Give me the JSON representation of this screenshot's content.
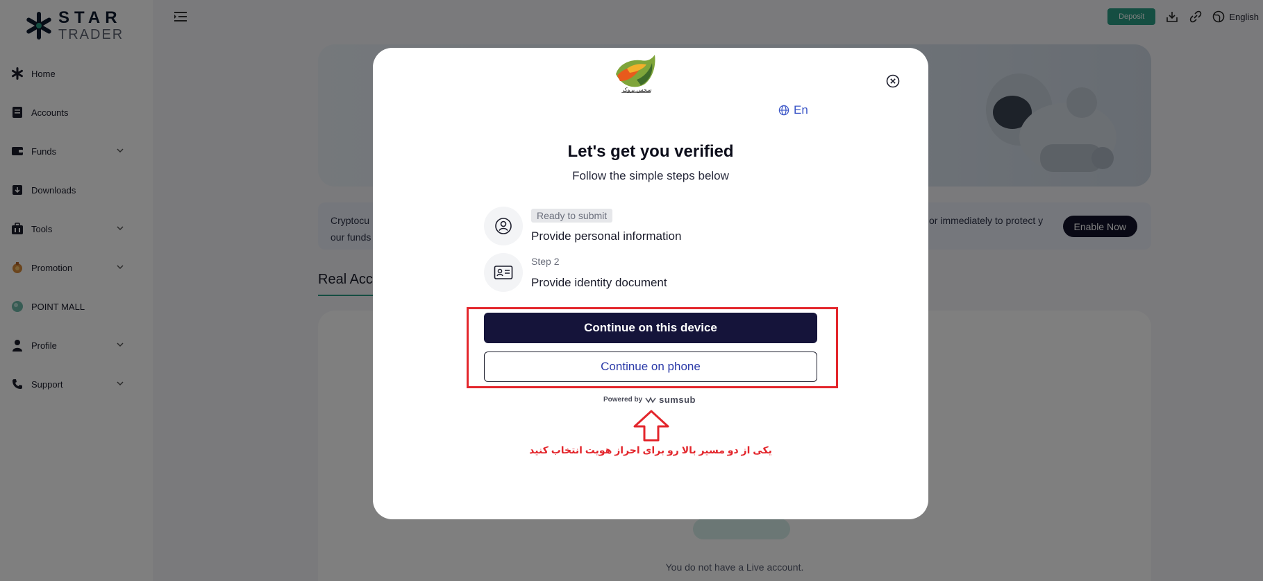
{
  "brand": {
    "star": "STAR",
    "trader": "TRADER"
  },
  "sidebar": {
    "items": [
      {
        "label": "Home",
        "icon": "home-star-icon"
      },
      {
        "label": "Accounts",
        "icon": "accounts-icon"
      },
      {
        "label": "Funds",
        "icon": "wallet-icon",
        "expandable": true
      },
      {
        "label": "Downloads",
        "icon": "download-icon"
      },
      {
        "label": "Tools",
        "icon": "tools-icon",
        "expandable": true
      },
      {
        "label": "Promotion",
        "icon": "promotion-icon",
        "expandable": true
      },
      {
        "label": "POINT MALL",
        "icon": "point-mall-icon"
      },
      {
        "label": "Profile",
        "icon": "user-icon",
        "expandable": true
      },
      {
        "label": "Support",
        "icon": "phone-icon",
        "expandable": true
      }
    ]
  },
  "topbar": {
    "deposit_label": "Deposit",
    "language": "English"
  },
  "page": {
    "notice_left": "Cryptocu our funds",
    "notice_right": "or immediately to protect y",
    "enable_label": "Enable Now",
    "tab_real": "Real Accounts",
    "no_account": "You do not have a Live account."
  },
  "modal": {
    "lang": "En",
    "title": "Let's get you verified",
    "subtitle": "Follow the simple steps below",
    "steps": [
      {
        "badge": "Ready to submit",
        "text": "Provide personal information"
      },
      {
        "badge": "Step 2",
        "text": "Provide identity document"
      }
    ],
    "btn_device": "Continue on this device",
    "btn_phone": "Continue on phone",
    "powered_by": "Powered by",
    "powered_brand": "sumsub",
    "annotation": "یکی از دو مسیر بالا رو برای احراز هویت انتخاب کنید"
  },
  "colors": {
    "accent": "#2a9d84",
    "primary_dark": "#15143a",
    "annotation_red": "#e3262c"
  }
}
